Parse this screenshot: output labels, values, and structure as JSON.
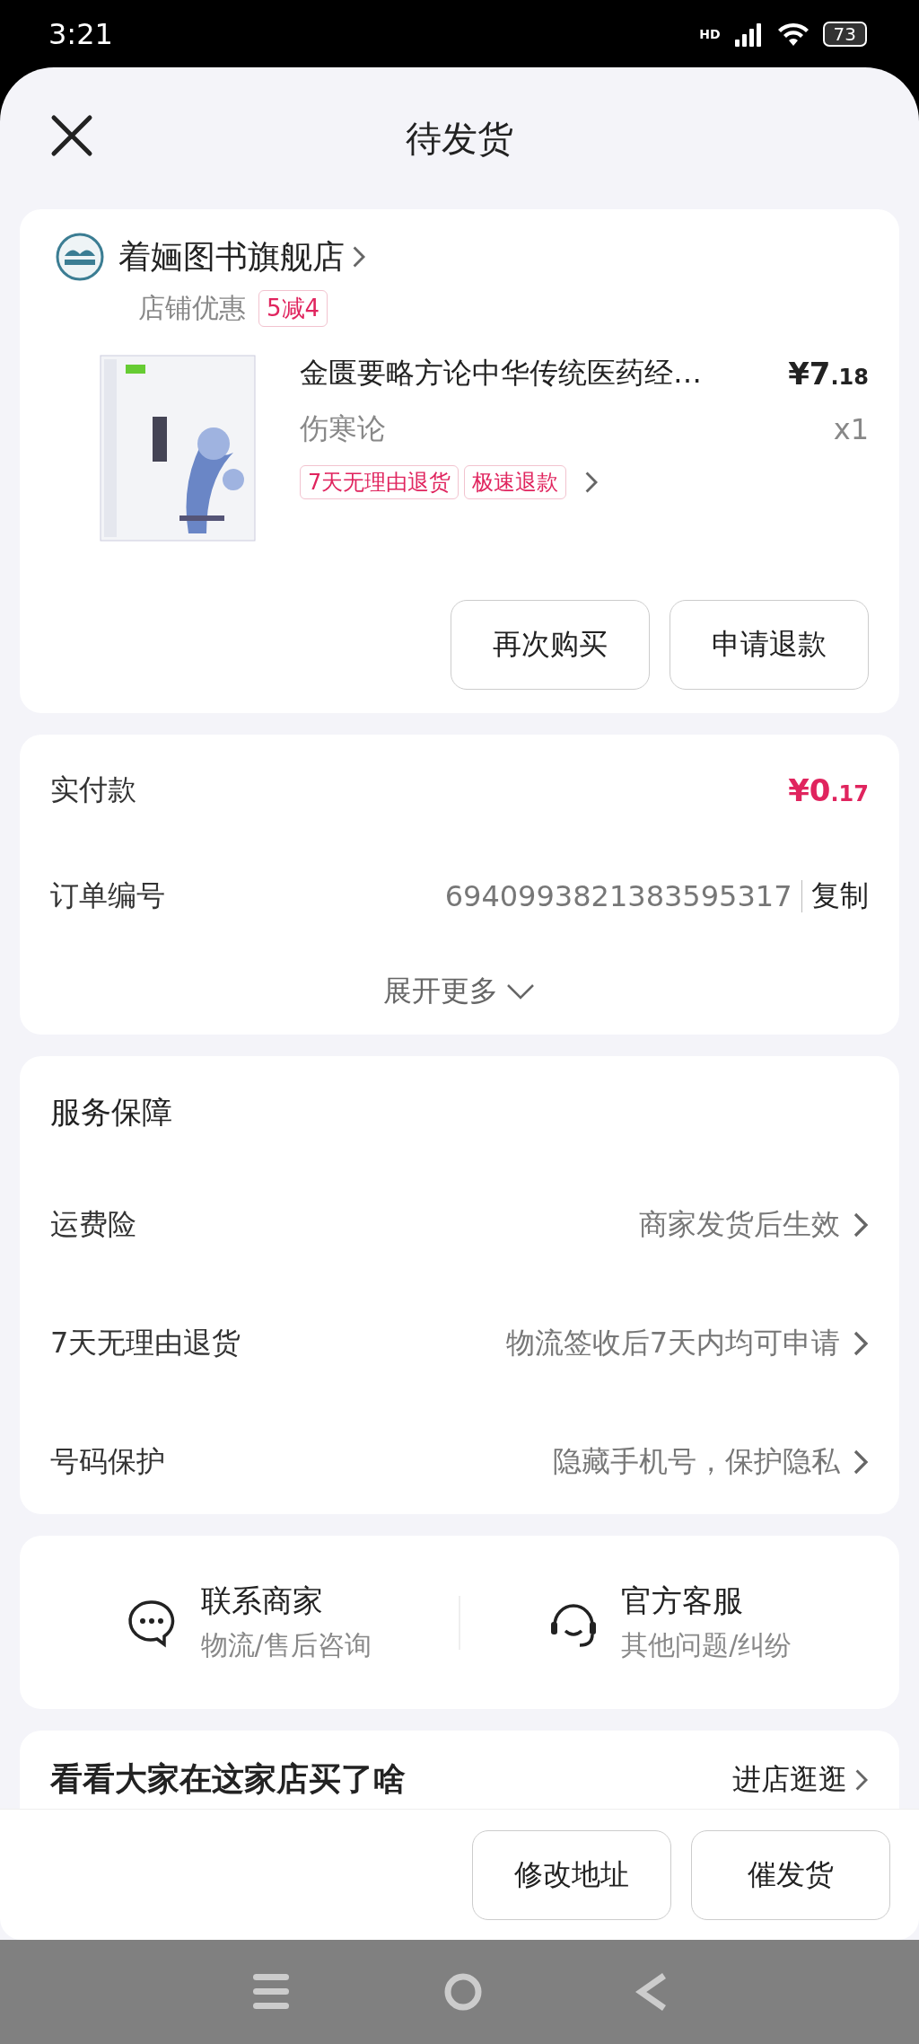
{
  "status_bar": {
    "time": "3:21",
    "network": "HD",
    "battery": "73"
  },
  "header": {
    "title": "待发货"
  },
  "store": {
    "name": "着婳图书旗舰店",
    "promo_label": "店铺优惠",
    "promo_tag": "5减4",
    "product": {
      "title": "金匮要略方论中华传统医药经…",
      "subtitle": "伤寒论",
      "price_main": "¥7",
      "price_cents": ".18",
      "quantity": "x1",
      "tags": [
        "7天无理由退货",
        "极速退款"
      ]
    },
    "buttons": [
      "再次购买",
      "申请退款"
    ]
  },
  "payment": {
    "rows": [
      {
        "kind": "price",
        "label": "实付款",
        "value_main": "¥0",
        "value_cents": ".17"
      },
      {
        "kind": "copy",
        "label": "订单编号",
        "value": "6940993821383595317",
        "action": "复制"
      }
    ],
    "expand": "展开更多"
  },
  "services": {
    "title": "服务保障",
    "rows": [
      {
        "label": "运费险",
        "value": "商家发货后生效"
      },
      {
        "label": "7天无理由退货",
        "value": "物流签收后7天内均可申请"
      },
      {
        "label": "号码保护",
        "value": "隐藏手机号，保护隐私"
      }
    ]
  },
  "contacts": [
    {
      "kind": "chat",
      "title": "联系商家",
      "subtitle": "物流/售后咨询"
    },
    {
      "kind": "headset",
      "title": "官方客服",
      "subtitle": "其他问题/纠纷"
    }
  ],
  "recommend": {
    "title": "看看大家在这家店买了啥",
    "link": "进店逛逛"
  },
  "bottom_buttons": [
    "修改地址",
    "催发货"
  ]
}
